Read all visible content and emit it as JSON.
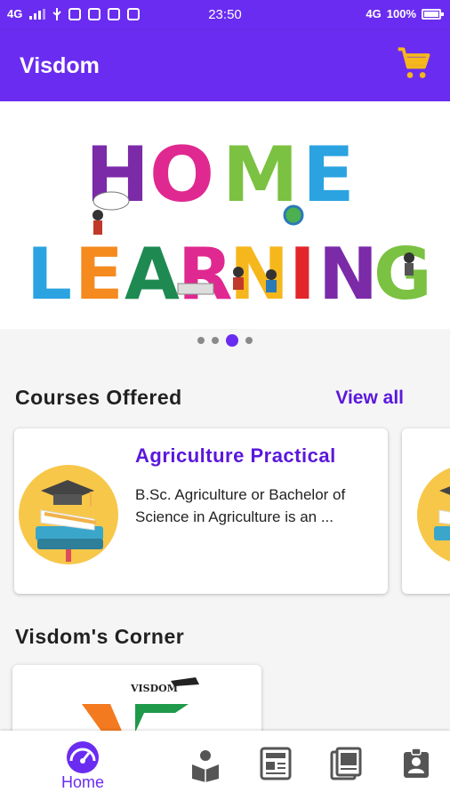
{
  "status": {
    "network_left": "4G",
    "time": "23:50",
    "network_right": "4G",
    "battery": "100%",
    "battery_level": 1.0
  },
  "appbar": {
    "title": "Visdom",
    "cart_icon": "shopping-cart-icon"
  },
  "banner": {
    "line1": [
      "H",
      "O",
      "M",
      "E"
    ],
    "line2": [
      "L",
      "E",
      "A",
      "R",
      "N",
      "I",
      "N",
      "G"
    ],
    "pages": 4,
    "active_page": 3
  },
  "courses": {
    "title": "Courses Offered",
    "view_all": "View all",
    "items": [
      {
        "title": "Agriculture Practical",
        "description": "B.Sc. Agriculture or Bachelor of Science in Agriculture is an ..."
      }
    ]
  },
  "corner": {
    "title": "Visdom's Corner",
    "logo_text": "VISDOM"
  },
  "bottom_nav": {
    "home_label": "Home",
    "items": [
      "speedometer-icon",
      "reading-icon",
      "news-icon",
      "gallery-icon",
      "profile-icon"
    ]
  },
  "colors": {
    "primary": "#6a2cf0",
    "accent": "#5a17dc",
    "cart": "#f5b71c"
  }
}
